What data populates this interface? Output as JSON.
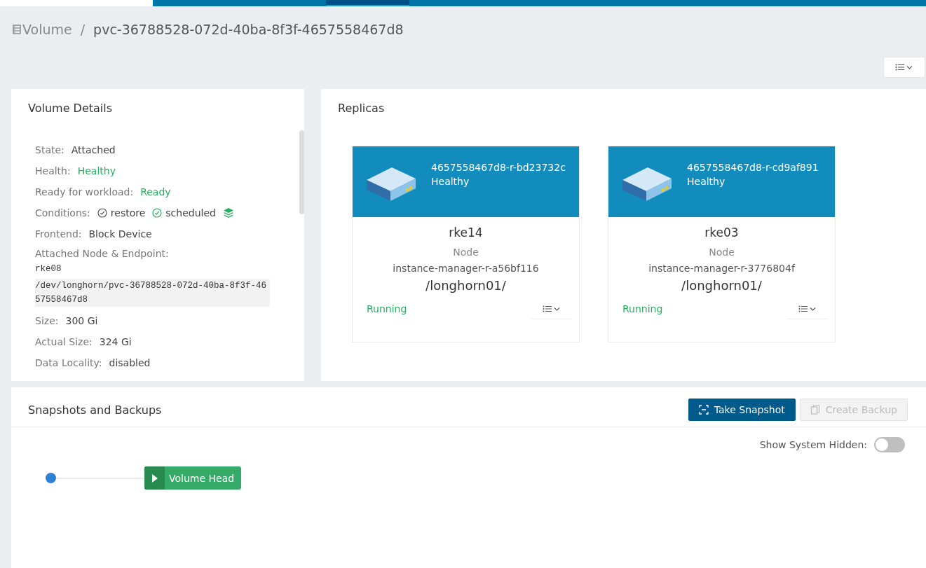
{
  "breadcrumb": {
    "parent": "Volume",
    "separator": "/",
    "current": "pvc-36788528-072d-40ba-8f3f-4657558467d8"
  },
  "volume_details": {
    "title": "Volume Details",
    "rows": [
      {
        "kind": "text",
        "label": "State:",
        "value": "Attached"
      },
      {
        "kind": "status",
        "label": "Health:",
        "value": "Healthy"
      },
      {
        "kind": "status",
        "label": "Ready for workload:",
        "value": "Ready"
      },
      {
        "kind": "conditions",
        "label": "Conditions:",
        "conditions": [
          {
            "name": "restore",
            "ok": false
          },
          {
            "name": "scheduled",
            "ok": true
          }
        ]
      },
      {
        "kind": "text",
        "label": "Frontend:",
        "value": "Block Device"
      },
      {
        "kind": "endpoint",
        "label": "Attached Node & Endpoint:",
        "node": "rke08",
        "endpoint": "/dev/longhorn/pvc-36788528-072d-40ba-8f3f-4657558467d8"
      },
      {
        "kind": "text",
        "label": "Size:",
        "value": "300 Gi"
      },
      {
        "kind": "text",
        "label": "Actual Size:",
        "value": "324 Gi"
      },
      {
        "kind": "text",
        "label": "Data Locality:",
        "value": "disabled"
      }
    ]
  },
  "replicas": {
    "title": "Replicas",
    "items": [
      {
        "name": "4657558467d8-r-bd23732c",
        "health": "Healthy",
        "node": "rke14",
        "node_label": "Node",
        "instance_manager": "instance-manager-r-a56bf116",
        "path": "/longhorn01/",
        "state": "Running"
      },
      {
        "name": "4657558467d8-r-cd9af891",
        "health": "Healthy",
        "node": "rke03",
        "node_label": "Node",
        "instance_manager": "instance-manager-r-3776804f",
        "path": "/longhorn01/",
        "state": "Running"
      }
    ]
  },
  "snapshots": {
    "title": "Snapshots and Backups",
    "buttons": [
      {
        "label": "Take Snapshot",
        "disabled": false
      },
      {
        "label": "Create Backup",
        "disabled": true
      }
    ],
    "show_system_hidden": {
      "label": "Show System Hidden:",
      "on": false
    },
    "head": {
      "label": "Volume Head"
    }
  }
}
